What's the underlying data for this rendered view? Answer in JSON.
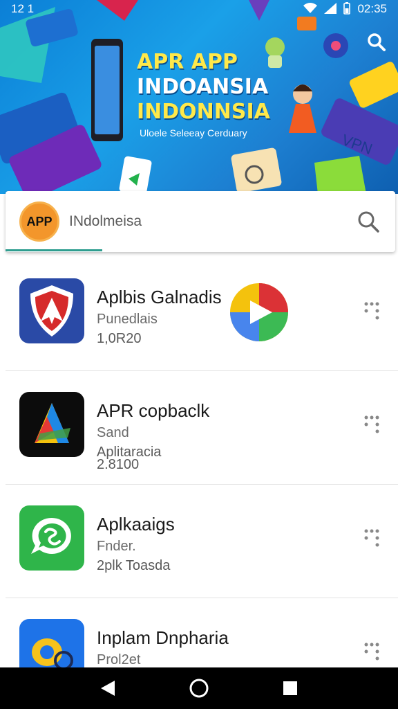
{
  "status_bar": {
    "left_text": "12 1",
    "time": "02:35",
    "icons": [
      "wifi-icon",
      "signal-icon",
      "battery-icon"
    ]
  },
  "banner": {
    "title_line1": "APR APP",
    "title_line2": "INDOANSIA",
    "title_line3": "INDONNSIA",
    "subtitle": "Uloele Seleeay Cerduary",
    "deco_text_vpn": "VPN"
  },
  "search": {
    "logo_text": "APP",
    "value": "INdolmeisa"
  },
  "apps": [
    {
      "name": "Aplbis Galnadis",
      "line1": "Punedlais",
      "line2": "1,0R20",
      "line3": ""
    },
    {
      "name": "APR copbaclk",
      "line1": "Sand",
      "line2": "Aplitaracia",
      "line3": "2.8100"
    },
    {
      "name": "Aplkaaigs",
      "line1": "Fnder.",
      "line2": "2plk Toasda",
      "line3": ""
    },
    {
      "name": "Inplam Dnpharia",
      "line1": "Prol2et",
      "line2": "",
      "line3": ""
    }
  ],
  "colors": {
    "banner_blue": "#1aa0e8",
    "title_yellow": "#ffe94a",
    "accent_teal": "#2e9d8f",
    "logo_orange": "#f3962b"
  }
}
